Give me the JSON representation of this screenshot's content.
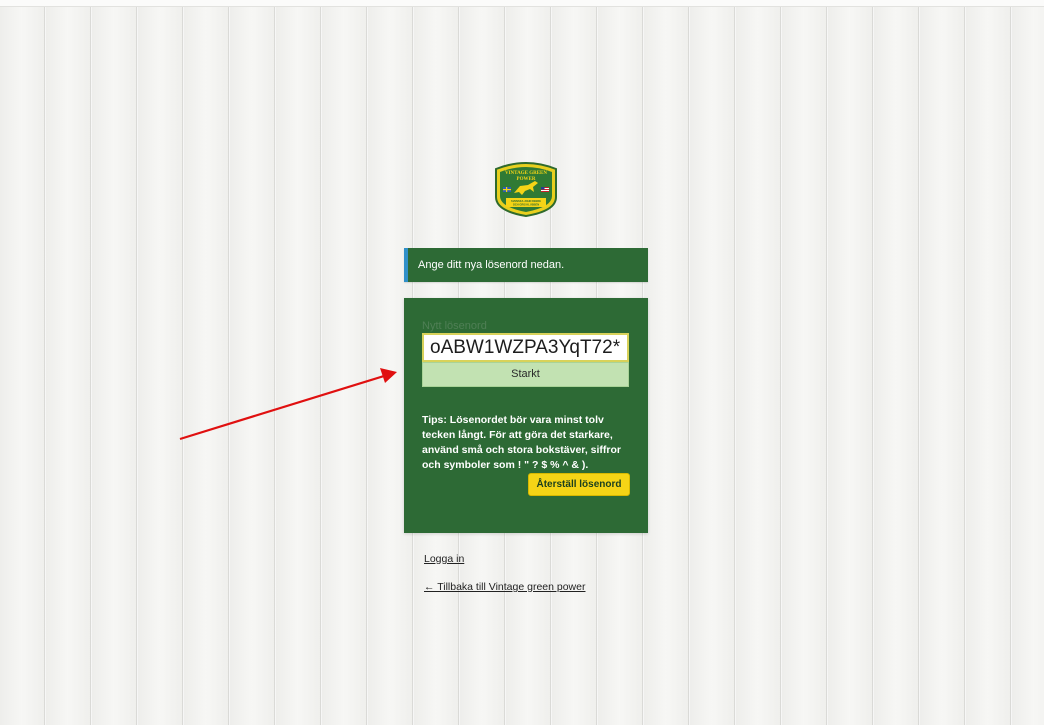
{
  "logo": {
    "text_top": "VINTAGE GREEN",
    "text_mid": "POWER",
    "text_bottom_1": "SVENSKA JOHN DEERE",
    "text_bottom_2": "OCH GRIS KLUBBEN"
  },
  "notice": {
    "message": "Ange ditt nya lösenord nedan."
  },
  "form": {
    "password_label": "Nytt lösenord",
    "password_value": "oABW1WZPA3YqT72*",
    "strength_label": "Starkt",
    "hint": "Tips: Lösenordet bör vara minst tolv tecken långt. För att göra det starkare, använd små och stora bokstäver, siffror och symboler som ! \" ? $ % ^ & ).",
    "submit_label": "Återställ lösenord"
  },
  "nav": {
    "login_label": "Logga in",
    "back_label": "← Tillbaka till Vintage green power"
  },
  "colors": {
    "panel_green": "#2d6a35",
    "notice_accent": "#2f8fc8",
    "button_yellow": "#f5d416",
    "strength_green": "#c2e2b2",
    "annotation_red": "#e01010"
  }
}
